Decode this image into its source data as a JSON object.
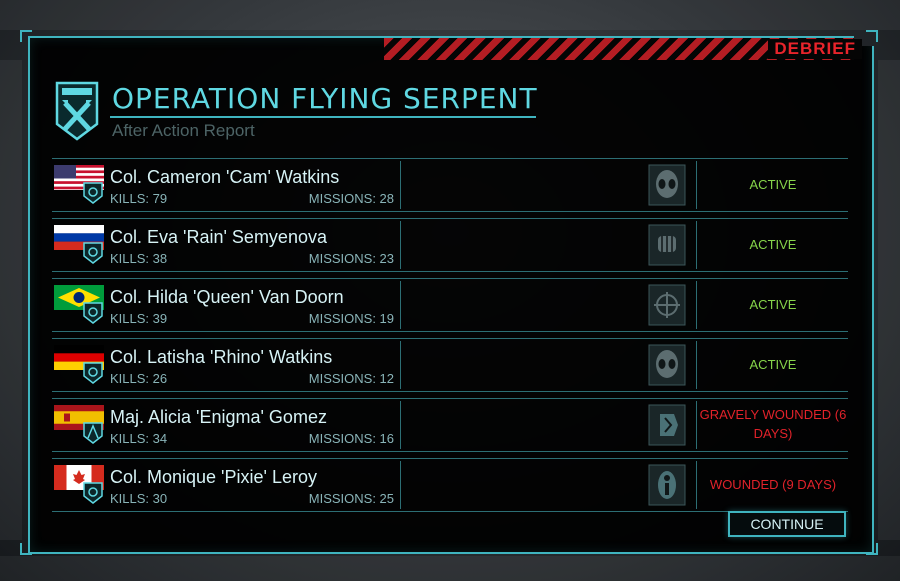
{
  "header": {
    "tag": "DEBRIEF",
    "operation_title": "OPERATION FLYING SERPENT",
    "subtitle": "After Action Report"
  },
  "colors": {
    "accent": "#3fb4bf",
    "title": "#5fd8e2",
    "active": "#86d34a",
    "wounded": "#e1222a",
    "stripe_red": "#b41d23"
  },
  "soldiers": [
    {
      "flag": "us-flag",
      "name": "Col. Cameron 'Cam' Watkins",
      "kills": "KILLS: 79",
      "missions": "MISSIONS: 28",
      "class_icon": "alien-head-icon",
      "status": "ACTIVE",
      "status_type": "active"
    },
    {
      "flag": "russia-flag",
      "name": "Col. Eva 'Rain' Semyenova",
      "kills": "KILLS: 38",
      "missions": "MISSIONS: 23",
      "class_icon": "fist-icon",
      "status": "ACTIVE",
      "status_type": "active"
    },
    {
      "flag": "brazil-flag",
      "name": "Col. Hilda 'Queen' Van Doorn",
      "kills": "KILLS: 39",
      "missions": "MISSIONS: 19",
      "class_icon": "crosshair-icon",
      "status": "ACTIVE",
      "status_type": "active"
    },
    {
      "flag": "germany-flag",
      "name": "Col. Latisha 'Rhino' Watkins",
      "kills": "KILLS: 26",
      "missions": "MISSIONS: 12",
      "class_icon": "alien-head-icon",
      "status": "ACTIVE",
      "status_type": "active"
    },
    {
      "flag": "spain-flag",
      "name": "Maj. Alicia 'Enigma' Gomez",
      "kills": "KILLS: 34",
      "missions": "MISSIONS: 16",
      "class_icon": "psi-head-icon",
      "status": "GRAVELY WOUNDED (6 DAYS)",
      "status_type": "wounded"
    },
    {
      "flag": "canada-flag",
      "name": "Col. Monique 'Pixie' Leroy",
      "kills": "KILLS: 30",
      "missions": "MISSIONS: 25",
      "class_icon": "medic-icon",
      "status": "WOUNDED (9 DAYS)",
      "status_type": "wounded"
    }
  ],
  "footer": {
    "continue_label": "CONTINUE"
  }
}
